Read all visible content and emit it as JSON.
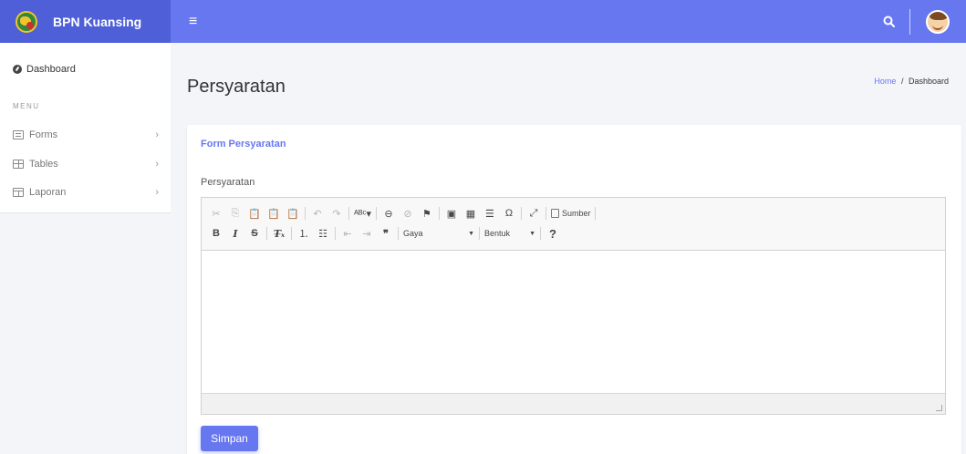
{
  "app": {
    "brand_name": "BPN Kuansing"
  },
  "topbar": {
    "menu_icon": "hamburger-icon",
    "search_icon": "search-icon",
    "avatar_icon": "user-avatar"
  },
  "sidebar": {
    "dashboard_label": "Dashboard",
    "menu_title": "MENU",
    "items": [
      {
        "label": "Forms",
        "icon": "form-icon"
      },
      {
        "label": "Tables",
        "icon": "table-icon"
      },
      {
        "label": "Laporan",
        "icon": "columns-icon"
      }
    ]
  },
  "page": {
    "title": "Persyaratan",
    "breadcrumb": {
      "home": "Home",
      "separator": "/",
      "current": "Dashboard"
    }
  },
  "form": {
    "card_title": "Form Persyaratan",
    "field_label": "Persyaratan",
    "editor": {
      "source_label": "Sumber",
      "style_combo": "Gaya",
      "format_combo": "Bentuk",
      "content": ""
    },
    "submit_label": "Simpan"
  },
  "colors": {
    "accent": "#6777ef",
    "brand_bg": "#4e5fd8",
    "page_bg": "#f4f5f9"
  }
}
